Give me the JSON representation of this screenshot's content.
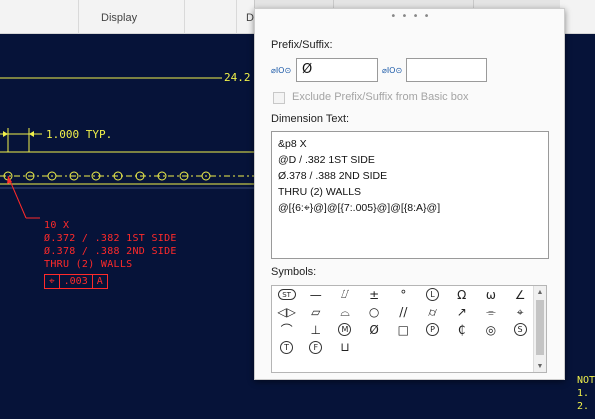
{
  "ribbon": {
    "group_display": "Display",
    "group_partial": "D"
  },
  "canvas": {
    "dim_top": "24.2",
    "dim_typ": "1.000 TYP.",
    "callout": [
      "10 X",
      "Ø.372 / .382 1ST SIDE",
      "Ø.378 / .388 2ND SIDE",
      "THRU (2) WALLS"
    ],
    "fcf": [
      "⌖",
      ".003",
      "A"
    ],
    "note_right": [
      "NOT",
      "1.",
      "2."
    ]
  },
  "panel": {
    "grip": "• • • •",
    "prefix_suffix_label": "Prefix/Suffix:",
    "prefix_icon": "⌀IO⊙",
    "prefix_value": "Ø",
    "suffix_icon": "⌀IO⊙",
    "suffix_value": "",
    "exclude_label": "Exclude Prefix/Suffix from Basic box",
    "dimension_text_label": "Dimension Text:",
    "dimension_text_lines": [
      "&p8 X",
      "@D / .382 1ST SIDE",
      "Ø.378 / .388 2ND SIDE",
      "THRU (2) WALLS",
      "@[{6:⌖}@]@[{7:.005}@]@[{8:A}@]"
    ],
    "symbols_label": "Symbols:",
    "symbols": [
      {
        "glyph": "ST",
        "name": "statistical-tolerance-icon",
        "style": "oval"
      },
      {
        "glyph": "—",
        "name": "straightness-icon",
        "style": ""
      },
      {
        "glyph": "⌰",
        "name": "total-runout-icon",
        "style": ""
      },
      {
        "glyph": "±",
        "name": "plus-minus-icon",
        "style": ""
      },
      {
        "glyph": "°",
        "name": "degree-icon",
        "style": ""
      },
      {
        "glyph": "L",
        "name": "lmc-icon",
        "style": "circ"
      },
      {
        "glyph": "Ω",
        "name": "ohm-icon",
        "style": ""
      },
      {
        "glyph": "ω",
        "name": "omega-icon",
        "style": ""
      },
      {
        "glyph": "∠",
        "name": "angularity-icon",
        "style": ""
      },
      {
        "glyph": "◁▷",
        "name": "between-arrow-icon",
        "style": ""
      },
      {
        "glyph": "▱",
        "name": "flatness-icon",
        "style": ""
      },
      {
        "glyph": "⌓",
        "name": "profile-surface-icon",
        "style": ""
      },
      {
        "glyph": "○",
        "name": "circularity-icon",
        "style": ""
      },
      {
        "glyph": "//",
        "name": "parallelism-icon",
        "style": ""
      },
      {
        "glyph": "⌭",
        "name": "cylindricity-icon",
        "style": ""
      },
      {
        "glyph": "↗",
        "name": "circular-runout-icon",
        "style": ""
      },
      {
        "glyph": "⌯",
        "name": "symmetry-icon",
        "style": ""
      },
      {
        "glyph": "⌖",
        "name": "position-icon",
        "style": ""
      },
      {
        "glyph": "⌒",
        "name": "profile-line-icon",
        "style": ""
      },
      {
        "glyph": "⊥",
        "name": "perpendicularity-icon",
        "style": ""
      },
      {
        "glyph": "M",
        "name": "mmc-icon",
        "style": "circ"
      },
      {
        "glyph": "Ø",
        "name": "diameter-icon",
        "style": ""
      },
      {
        "glyph": "□",
        "name": "square-icon",
        "style": ""
      },
      {
        "glyph": "P",
        "name": "projected-zone-icon",
        "style": "circ"
      },
      {
        "glyph": "₵",
        "name": "centerline-icon",
        "style": ""
      },
      {
        "glyph": "◎",
        "name": "concentricity-icon",
        "style": ""
      },
      {
        "glyph": "S",
        "name": "rfs-icon",
        "style": "circ"
      },
      {
        "glyph": "T",
        "name": "tangent-plane-icon",
        "style": "circ"
      },
      {
        "glyph": "F",
        "name": "free-state-icon",
        "style": "circ"
      },
      {
        "glyph": "⊔",
        "name": "counterbore-icon",
        "style": ""
      }
    ]
  }
}
